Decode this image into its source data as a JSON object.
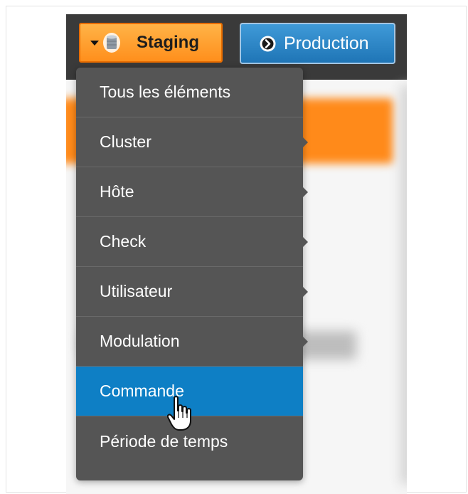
{
  "toolbar": {
    "staging_label": "Staging",
    "production_label": "Production"
  },
  "menu": {
    "items": [
      {
        "label": "Tous les éléments",
        "has_submenu": false,
        "active": false
      },
      {
        "label": "Cluster",
        "has_submenu": true,
        "active": false
      },
      {
        "label": "Hôte",
        "has_submenu": true,
        "active": false
      },
      {
        "label": "Check",
        "has_submenu": true,
        "active": false
      },
      {
        "label": "Utilisateur",
        "has_submenu": true,
        "active": false
      },
      {
        "label": "Modulation",
        "has_submenu": true,
        "active": false
      },
      {
        "label": "Commande",
        "has_submenu": false,
        "active": true
      },
      {
        "label": "Période de temps",
        "has_submenu": false,
        "active": false
      }
    ]
  },
  "colors": {
    "staging_accent": "#ff8f1c",
    "production_accent": "#1f75b6",
    "menu_bg": "#555555",
    "menu_active": "#0e7fc5"
  },
  "icons": {
    "staging": "database-icon",
    "production": "arrow-circle-right-icon",
    "pointer": "hand-pointer-icon"
  }
}
